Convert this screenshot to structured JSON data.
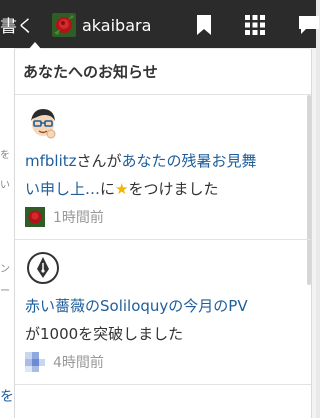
{
  "topbar": {
    "write_label": "書く",
    "username": "akaibara"
  },
  "panel": {
    "title": "あなたへのお知らせ"
  },
  "background": {
    "left_fragments": [
      "を",
      "い",
      "ン",
      "ー"
    ],
    "left_link": "を"
  },
  "notifications": [
    {
      "actor": "mfblitz",
      "text_1": "さんが",
      "target": "あなたの残暑お見舞い申し上…",
      "text_2": "に",
      "star": "★",
      "text_3": "をつけました",
      "time": "1時間前"
    },
    {
      "link": "赤い薔薇のSoliloquyの今月のPV",
      "text": "が1000を突破しました",
      "time": "4時間前"
    }
  ]
}
